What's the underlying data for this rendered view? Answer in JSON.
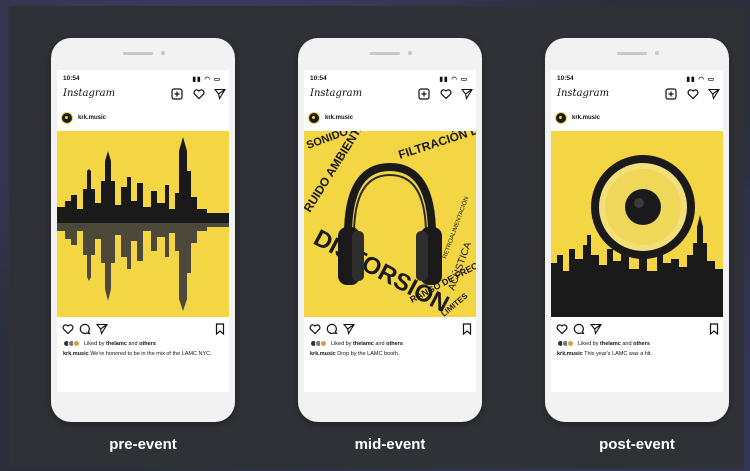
{
  "brand": {
    "accent": "#f4d544",
    "dark": "#111111"
  },
  "phones": [
    {
      "time": "10:54",
      "app_name": "Instagram",
      "username": "krk.music",
      "liked_by": "Liked by",
      "liked_name": "thelamc",
      "liked_and": "and",
      "liked_others": "others",
      "caption_user": "krk.music",
      "caption_text": "We're honored to be in the mix of the LAMC NYC.",
      "label": "pre-event"
    },
    {
      "time": "10:54",
      "app_name": "Instagram",
      "username": "krk.music",
      "liked_by": "Liked by",
      "liked_name": "thelamc",
      "liked_and": "and",
      "liked_others": "others",
      "caption_user": "krk.music",
      "caption_text": "Drop by the LAMC booth.",
      "label": "mid-event",
      "art_words": [
        "SONIDO SUCIO",
        "FILTRACIÓN DE RUIDOS",
        "RUIDO AMBIENTAL",
        "DISTORSIÓN",
        "RANGO DE FRECUENCIAS",
        "ACÚSTICA",
        "RETROALIMENTACIÓN",
        "LIMITES"
      ]
    },
    {
      "time": "10:54",
      "app_name": "Instagram",
      "username": "krk.music",
      "liked_by": "Liked by",
      "liked_name": "thelamc",
      "liked_and": "and",
      "liked_others": "others",
      "caption_user": "krk.music",
      "caption_text": "This year's LAMC was a hit.",
      "label": "post-event"
    }
  ]
}
